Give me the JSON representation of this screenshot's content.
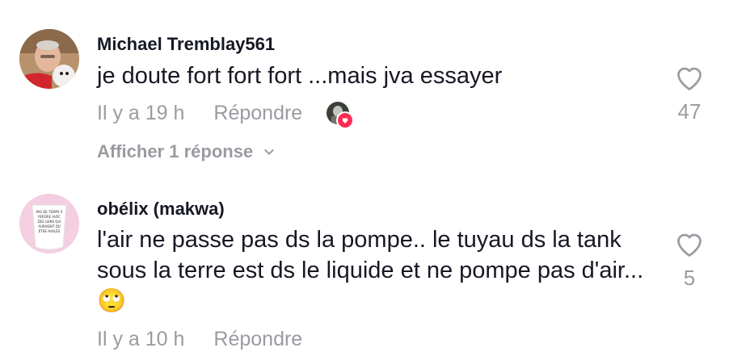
{
  "comments": [
    {
      "username": "Michael Tremblay561",
      "text": "je doute fort fort fort ...mais jva essayer",
      "time": "Il y a 19 h",
      "reply_label": "Répondre",
      "likes": "47",
      "show_replies_label": "Afficher 1 réponse",
      "liked_by_creator": true
    },
    {
      "username": "obélix (makwa)",
      "text": "l'air ne passe pas ds la pompe.. le tuyau ds la tank sous la terre est ds le liquide et ne pompe pas d'air... 🙄",
      "time": "Il y a 10 h",
      "reply_label": "Répondre",
      "likes": "5",
      "avatar_caption": "PAS DE TEMPS À PERDRE AVEC DES GENS QUI AURAIENT DÛ ÊTRE AVALÉS"
    }
  ],
  "colors": {
    "primary_text": "#161823",
    "secondary_text": "#9a9ba1",
    "accent": "#fe2c55"
  },
  "icons": {
    "like": "heart-outline-icon",
    "expand": "chevron-down-icon",
    "creator_like": "heart-badge-icon"
  }
}
